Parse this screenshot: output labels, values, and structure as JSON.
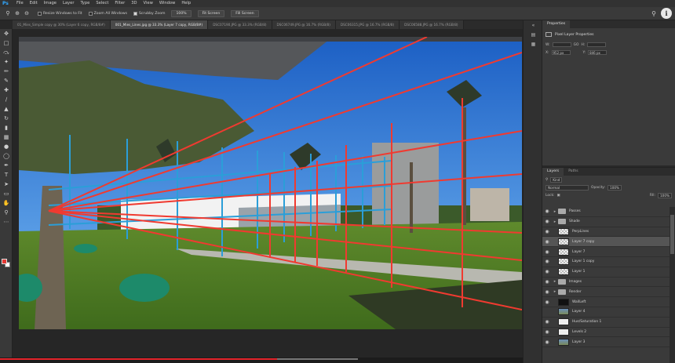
{
  "app": {
    "logo": "Ps"
  },
  "menu": [
    "File",
    "Edit",
    "Image",
    "Layer",
    "Type",
    "Select",
    "Filter",
    "3D",
    "View",
    "Window",
    "Help"
  ],
  "options_bar": {
    "resize_windows": "Resize Windows to Fit",
    "zoom_all": "Zoom All Windows",
    "scrubby_zoom": "Scrubby Zoom",
    "btn_100": "100%",
    "fit_screen": "Fit Screen",
    "fill_screen": "Fill Screen"
  },
  "doc_tabs": [
    {
      "label": "01_Mies_Simple copy @ 30% (Layer 6 copy, RGB/8#)",
      "active": false
    },
    {
      "label": "001_Mies_Lines.jpg @ 33.3% (Layer 7 copy, RGB/8#)",
      "active": true
    },
    {
      "label": "DSC07190.JPG @ 33.3% (RGB/8)",
      "active": false
    },
    {
      "label": "DSC06749.JPG @ 16.7% (RGB/8)",
      "active": false
    },
    {
      "label": "DSC06315.JPG @ 16.7% (RGB/8)",
      "active": false
    },
    {
      "label": "DSC06588.JPG @ 16.7% (RGB/8)",
      "active": false
    }
  ],
  "properties": {
    "tab": "Properties",
    "title": "Pixel Layer Properties",
    "w_label": "W:",
    "h_label": "H:",
    "go": "GO",
    "x_label": "X:",
    "x_value": "952 px",
    "y_label": "Y:",
    "y_value": "846 px"
  },
  "layers_panel": {
    "tab_layers": "Layers",
    "tab_paths": "Paths",
    "kind": "Kind",
    "blend_mode": "Normal",
    "opacity_label": "Opacity:",
    "opacity": "100%",
    "lock_label": "Lock:",
    "fill_label": "Fill:",
    "fill": "100%",
    "rows": [
      {
        "name": "Passes",
        "type": "folder",
        "visible": true
      },
      {
        "name": "Shade",
        "type": "folder",
        "visible": true
      },
      {
        "name": "PerpLines",
        "type": "check",
        "visible": true
      },
      {
        "name": "Layer 7 copy",
        "type": "check",
        "visible": true,
        "selected": true
      },
      {
        "name": "Layer 7",
        "type": "check",
        "visible": true
      },
      {
        "name": "Layer 1 copy",
        "type": "check",
        "visible": true
      },
      {
        "name": "Layer 1",
        "type": "check",
        "visible": true
      },
      {
        "name": "Images",
        "type": "folder",
        "visible": true
      },
      {
        "name": "Render",
        "type": "folder",
        "visible": true
      },
      {
        "name": "WallLeft",
        "type": "black",
        "visible": true
      },
      {
        "name": "Layer 4",
        "type": "photo",
        "visible": false
      },
      {
        "name": "Hue/Saturation 1",
        "type": "white",
        "visible": true
      },
      {
        "name": "Levels 2",
        "type": "white",
        "visible": true
      },
      {
        "name": "Layer 3",
        "type": "photo",
        "visible": true
      }
    ]
  },
  "progress": {
    "played_fraction": 0.41
  },
  "colors": {
    "accent": "#31a8ff",
    "foreground_swatch": "#e53935",
    "background_swatch": "#ffffff",
    "progress": "#e4242a"
  }
}
